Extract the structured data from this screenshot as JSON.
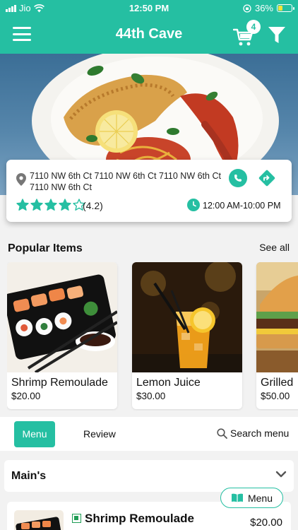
{
  "status_bar": {
    "carrier": "Jio",
    "time": "12:50 PM",
    "battery": "36%"
  },
  "header": {
    "title": "44th Cave",
    "cart_count": "4",
    "icons": {
      "menu": "hamburger-icon",
      "cart": "cart-icon",
      "filter": "filter-icon"
    }
  },
  "restaurant": {
    "address": "7110 NW 6th Ct 7110 NW 6th Ct 7110 NW 6th Ct 7110 NW 6th Ct",
    "rating": 4.2,
    "rating_text": "(4.2)",
    "rating_max": 5,
    "hours": "12:00 AM-10:00 PM"
  },
  "popular": {
    "title": "Popular Items",
    "see_all": "See all",
    "items": [
      {
        "name": "Shrimp Remoulade",
        "price": "$20.00"
      },
      {
        "name": "Lemon Juice",
        "price": "$30.00"
      },
      {
        "name": "Grilled",
        "price": "$50.00"
      }
    ]
  },
  "tabs": {
    "menu": "Menu",
    "review": "Review",
    "search": "Search menu"
  },
  "category": {
    "label": "Main's"
  },
  "menu_items": [
    {
      "name": "Shrimp Remoulade",
      "price": "$20.00"
    }
  ],
  "floating": {
    "label": "Menu"
  },
  "colors": {
    "accent": "#25bfa2",
    "star": "#25bfa2"
  }
}
